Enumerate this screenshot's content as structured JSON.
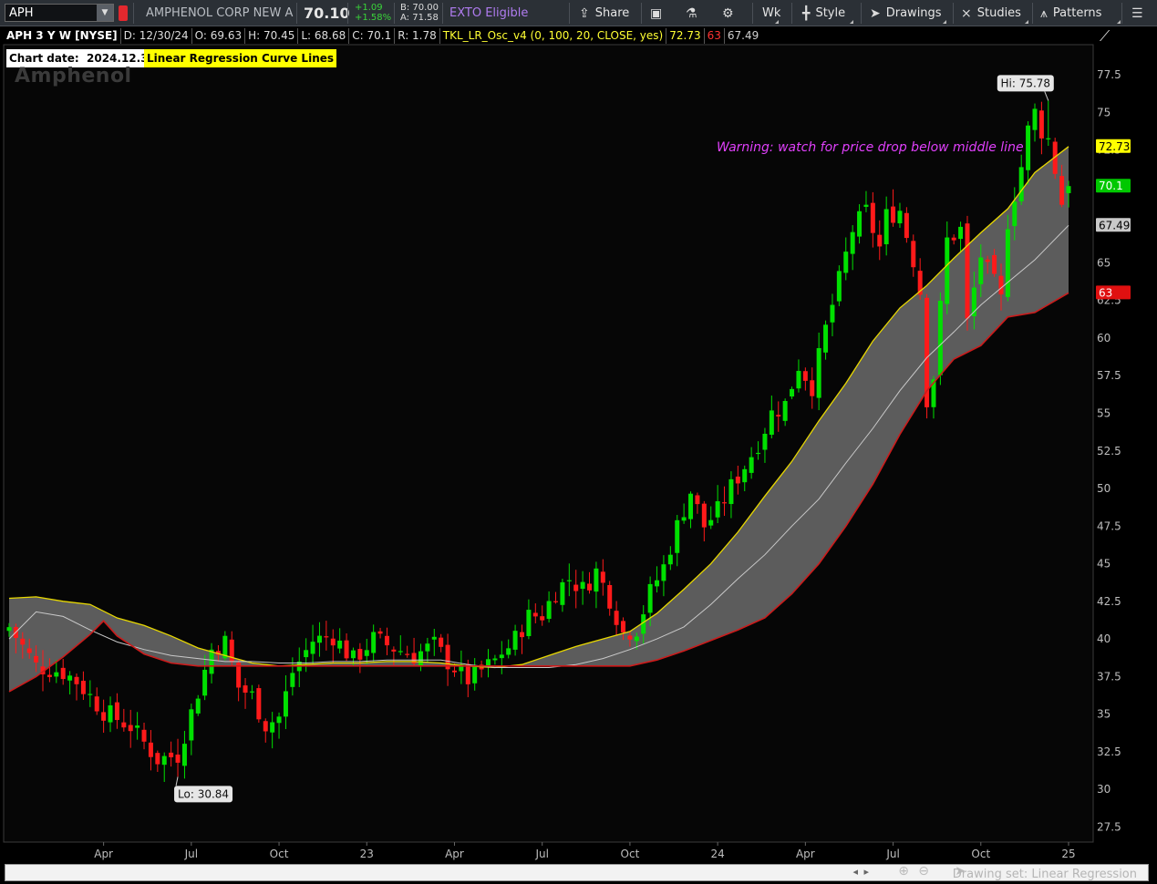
{
  "toolbar": {
    "symbol": "APHh",
    "symbol_value": "APH",
    "company": "AMPHENOL CORP NEW A",
    "last": "70.10",
    "change": "+1.09",
    "change_pct": "+1.58%",
    "bid": "B: 70.00",
    "ask": "A: 71.58",
    "exto": "EXTO Eligible",
    "share": "Share",
    "period": "Wk",
    "style": "Style",
    "drawings": "Drawings",
    "studies": "Studies",
    "patterns": "Patterns"
  },
  "header": {
    "title": "APH 3 Y W [NYSE]",
    "date": "D: 12/30/24",
    "open": "O: 69.63",
    "high": "H: 70.45",
    "low": "L: 68.68",
    "close": "C: 70.1",
    "range": "R: 1.78",
    "study": "TKL_LR_Osc_v4 (0, 100, 20, CLOSE, yes)",
    "study_upper": "72.73",
    "study_lower": "63",
    "study_mid": "67.49"
  },
  "badges": {
    "chart_date_label": "Chart date:",
    "chart_date": "2024.12.30",
    "study_name": "Linear Regression Curve Lines"
  },
  "watermark": "Amphenol",
  "warning": "Warning:  watch for price drop below middle line",
  "bottom": {
    "drawing_set": "Drawing set: Linear Regression"
  },
  "colors": {
    "up": "#00e000",
    "down": "#ff1a1a",
    "upper_line": "#e8d800",
    "lower_line": "#cc1b1b",
    "mid_line": "#c9c9c9",
    "band_fill": "#616161"
  },
  "chart_data": {
    "type": "candlestick",
    "title": "APH 3 Y W [NYSE]",
    "y_range": [
      26.5,
      79.5
    ],
    "y_ticks": [
      27.5,
      30,
      32.5,
      35,
      37.5,
      40,
      42.5,
      45,
      47.5,
      50,
      52.5,
      55,
      57.5,
      60,
      62.5,
      65,
      67.5,
      70,
      72.5,
      75,
      77.5
    ],
    "x_labels": [
      {
        "label": "Apr",
        "week": 14
      },
      {
        "label": "Jul",
        "week": 27
      },
      {
        "label": "Oct",
        "week": 40
      },
      {
        "label": "23",
        "week": 53
      },
      {
        "label": "Apr",
        "week": 66
      },
      {
        "label": "Jul",
        "week": 79
      },
      {
        "label": "Oct",
        "week": 92
      },
      {
        "label": "24",
        "week": 105
      },
      {
        "label": "Apr",
        "week": 118
      },
      {
        "label": "Jul",
        "week": 131
      },
      {
        "label": "Oct",
        "week": 144
      },
      {
        "label": "25",
        "week": 157
      }
    ],
    "weeks": 157,
    "close_points": [
      [
        0,
        40.8
      ],
      [
        4,
        38.2
      ],
      [
        8,
        37.8
      ],
      [
        10,
        37.2
      ],
      [
        14,
        35.2
      ],
      [
        18,
        34.2
      ],
      [
        22,
        32.0
      ],
      [
        25,
        32.3
      ],
      [
        28,
        36.5
      ],
      [
        30,
        39.3
      ],
      [
        32,
        39.8
      ],
      [
        34,
        36.8
      ],
      [
        36,
        36.2
      ],
      [
        38,
        34.3
      ],
      [
        40,
        34.8
      ],
      [
        42,
        37.8
      ],
      [
        45,
        39.9
      ],
      [
        48,
        40.2
      ],
      [
        51,
        38.6
      ],
      [
        54,
        40.0
      ],
      [
        57,
        39.4
      ],
      [
        60,
        38.9
      ],
      [
        63,
        39.6
      ],
      [
        65,
        38.5
      ],
      [
        68,
        37.3
      ],
      [
        71,
        38.2
      ],
      [
        73,
        38.9
      ],
      [
        75,
        40.0
      ],
      [
        77,
        41.5
      ],
      [
        79,
        41.6
      ],
      [
        81,
        43.2
      ],
      [
        83,
        44.0
      ],
      [
        85,
        43.3
      ],
      [
        87,
        44.5
      ],
      [
        89,
        42.7
      ],
      [
        91,
        40.4
      ],
      [
        93,
        40.7
      ],
      [
        95,
        43.1
      ],
      [
        97,
        44.8
      ],
      [
        99,
        47.5
      ],
      [
        101,
        49.8
      ],
      [
        103,
        47.5
      ],
      [
        105,
        48.5
      ],
      [
        107,
        50.1
      ],
      [
        109,
        51.5
      ],
      [
        111,
        53.0
      ],
      [
        113,
        55.0
      ],
      [
        115,
        55.6
      ],
      [
        117,
        58.2
      ],
      [
        119,
        56.8
      ],
      [
        121,
        60.6
      ],
      [
        123,
        63.8
      ],
      [
        125,
        67.2
      ],
      [
        127,
        68.4
      ],
      [
        129,
        66.0
      ],
      [
        130,
        68.1
      ],
      [
        132,
        68.5
      ],
      [
        134,
        65.2
      ],
      [
        135,
        63.1
      ],
      [
        136,
        56.0
      ],
      [
        137,
        57.5
      ],
      [
        139,
        66.5
      ],
      [
        141,
        67.2
      ],
      [
        142,
        61.0
      ],
      [
        144,
        65.5
      ],
      [
        146,
        63.6
      ],
      [
        147,
        62.5
      ],
      [
        148,
        67.8
      ],
      [
        150,
        71.4
      ],
      [
        151,
        73.8
      ],
      [
        152,
        75.0
      ],
      [
        153,
        73.8
      ],
      [
        154,
        73.2
      ],
      [
        155,
        71.2
      ],
      [
        156,
        69.0
      ],
      [
        157,
        70.1
      ]
    ],
    "high": {
      "label": "Hi: 75.78",
      "value": 75.78,
      "week": 154
    },
    "low": {
      "label": "Lo: 30.84",
      "value": 30.84,
      "week": 25
    },
    "upper_band": [
      [
        0,
        42.7
      ],
      [
        4,
        42.8
      ],
      [
        8,
        42.5
      ],
      [
        12,
        42.3
      ],
      [
        16,
        41.4
      ],
      [
        20,
        40.9
      ],
      [
        24,
        40.2
      ],
      [
        28,
        39.4
      ],
      [
        32,
        38.9
      ],
      [
        36,
        38.4
      ],
      [
        40,
        38.2
      ],
      [
        44,
        38.3
      ],
      [
        48,
        38.4
      ],
      [
        52,
        38.4
      ],
      [
        56,
        38.5
      ],
      [
        60,
        38.5
      ],
      [
        64,
        38.4
      ],
      [
        68,
        38.2
      ],
      [
        72,
        38.1
      ],
      [
        76,
        38.3
      ],
      [
        80,
        38.9
      ],
      [
        84,
        39.5
      ],
      [
        88,
        40.0
      ],
      [
        92,
        40.5
      ],
      [
        96,
        41.7
      ],
      [
        100,
        43.3
      ],
      [
        104,
        45.0
      ],
      [
        108,
        47.1
      ],
      [
        112,
        49.5
      ],
      [
        116,
        51.8
      ],
      [
        120,
        54.5
      ],
      [
        124,
        57.0
      ],
      [
        128,
        59.8
      ],
      [
        132,
        62.0
      ],
      [
        136,
        63.5
      ],
      [
        140,
        65.3
      ],
      [
        144,
        67.0
      ],
      [
        148,
        68.6
      ],
      [
        152,
        71.0
      ],
      [
        157,
        72.73
      ]
    ],
    "mid_line": [
      [
        0,
        40.0
      ],
      [
        4,
        41.8
      ],
      [
        8,
        41.5
      ],
      [
        12,
        40.6
      ],
      [
        16,
        39.8
      ],
      [
        20,
        39.3
      ],
      [
        24,
        38.9
      ],
      [
        28,
        38.7
      ],
      [
        32,
        38.5
      ],
      [
        36,
        38.5
      ],
      [
        40,
        38.4
      ],
      [
        44,
        38.4
      ],
      [
        48,
        38.5
      ],
      [
        52,
        38.5
      ],
      [
        56,
        38.6
      ],
      [
        60,
        38.6
      ],
      [
        64,
        38.6
      ],
      [
        68,
        38.3
      ],
      [
        72,
        38.1
      ],
      [
        76,
        38.1
      ],
      [
        80,
        38.1
      ],
      [
        84,
        38.3
      ],
      [
        88,
        38.7
      ],
      [
        92,
        39.3
      ],
      [
        96,
        40.0
      ],
      [
        100,
        40.8
      ],
      [
        104,
        42.3
      ],
      [
        108,
        44.0
      ],
      [
        112,
        45.6
      ],
      [
        116,
        47.5
      ],
      [
        120,
        49.3
      ],
      [
        124,
        51.7
      ],
      [
        128,
        54.0
      ],
      [
        132,
        56.5
      ],
      [
        136,
        58.7
      ],
      [
        140,
        60.4
      ],
      [
        144,
        62.2
      ],
      [
        148,
        63.7
      ],
      [
        152,
        65.2
      ],
      [
        157,
        67.49
      ]
    ],
    "lower_band": [
      [
        0,
        36.5
      ],
      [
        4,
        37.5
      ],
      [
        8,
        38.8
      ],
      [
        12,
        40.3
      ],
      [
        14,
        41.2
      ],
      [
        16,
        40.2
      ],
      [
        20,
        39.0
      ],
      [
        24,
        38.4
      ],
      [
        28,
        38.2
      ],
      [
        32,
        38.2
      ],
      [
        36,
        38.2
      ],
      [
        40,
        38.2
      ],
      [
        44,
        38.2
      ],
      [
        48,
        38.2
      ],
      [
        52,
        38.2
      ],
      [
        56,
        38.2
      ],
      [
        60,
        38.2
      ],
      [
        64,
        38.2
      ],
      [
        68,
        38.2
      ],
      [
        72,
        38.2
      ],
      [
        76,
        38.2
      ],
      [
        80,
        38.2
      ],
      [
        84,
        38.2
      ],
      [
        88,
        38.2
      ],
      [
        92,
        38.2
      ],
      [
        96,
        38.6
      ],
      [
        100,
        39.2
      ],
      [
        104,
        39.9
      ],
      [
        108,
        40.6
      ],
      [
        112,
        41.4
      ],
      [
        116,
        43.0
      ],
      [
        120,
        45.0
      ],
      [
        124,
        47.5
      ],
      [
        128,
        50.3
      ],
      [
        132,
        53.6
      ],
      [
        136,
        56.5
      ],
      [
        140,
        58.6
      ],
      [
        144,
        59.5
      ],
      [
        148,
        61.4
      ],
      [
        152,
        61.7
      ],
      [
        157,
        63.0
      ]
    ],
    "y_markers": [
      {
        "value": 72.73,
        "label": "72.73",
        "bg": "#ffff00",
        "fg": "#000"
      },
      {
        "value": 70.1,
        "label": "70.1",
        "bg": "#00c800",
        "fg": "#fff"
      },
      {
        "value": 67.49,
        "label": "67.49",
        "bg": "#c9c9c9",
        "fg": "#000"
      },
      {
        "value": 63,
        "label": "63",
        "bg": "#e01010",
        "fg": "#fff"
      }
    ]
  }
}
